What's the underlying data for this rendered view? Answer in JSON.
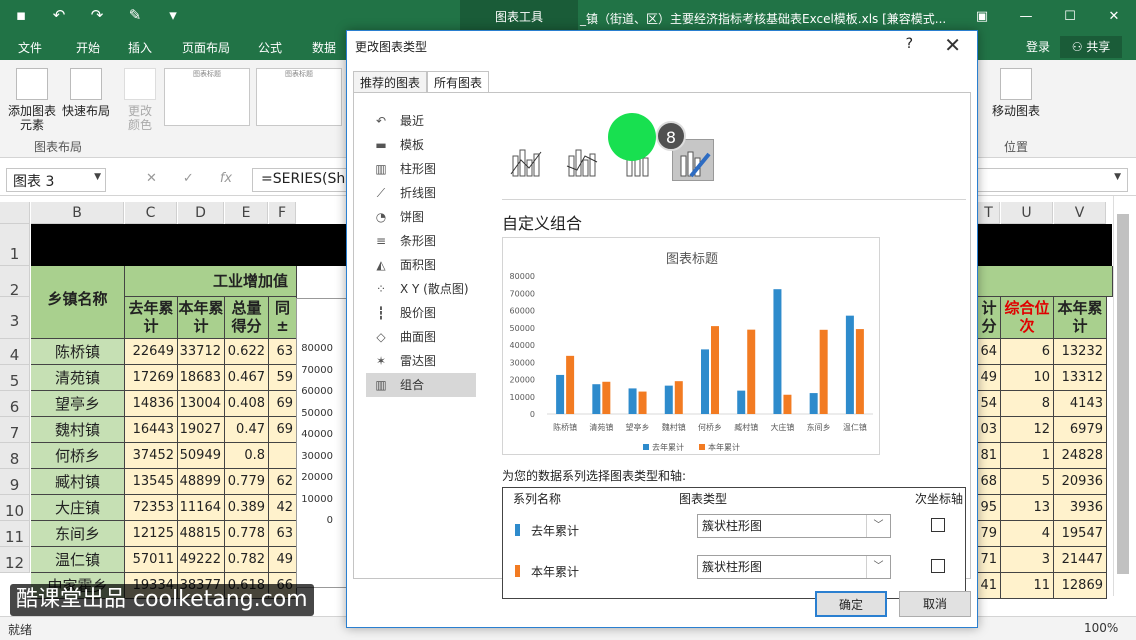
{
  "app": {
    "doc_title": "_镇（街道、区）主要经济指标考核基础表Excel模板.xls  [兼容模式...",
    "context_tab": "图表工具"
  },
  "ribbon_tabs": [
    "文件",
    "开始",
    "插入",
    "页面布局",
    "公式",
    "数据"
  ],
  "account": {
    "login": "登录",
    "share": "共享"
  },
  "ribbon": {
    "add_element": "添加图表\n元素",
    "quick_layout": "快速布局",
    "change_color": "更改\n颜色",
    "group_layout": "图表布局",
    "move_chart": "移动图表",
    "group_position": "位置",
    "thumb_title": "图表标题"
  },
  "formula_bar": {
    "name_box": "图表 3",
    "formula": "=SERIES(She"
  },
  "sheet": {
    "columns": [
      "B",
      "C",
      "D",
      "E",
      "F",
      "T",
      "U",
      "V"
    ],
    "rows": [
      "1",
      "2",
      "3",
      "4",
      "5",
      "6",
      "7",
      "8",
      "9",
      "10",
      "11",
      "12"
    ],
    "group_header": "工业增加值",
    "col_headers": [
      "乡镇名称",
      "去年累计",
      "本年累计",
      "总量得分",
      "同±",
      "计分",
      "综合位次",
      "本年累计"
    ],
    "names": [
      "陈桥镇",
      "清苑镇",
      "望亭乡",
      "魏村镇",
      "何桥乡",
      "臧村镇",
      "大庄镇",
      "东间乡",
      "温仁镇",
      "中家霍乡"
    ],
    "last_year": [
      "22649",
      "17269",
      "14836",
      "16443",
      "37452",
      "13545",
      "72353",
      "12125",
      "57011",
      "19334"
    ],
    "this_year": [
      "33712",
      "18683",
      "13004",
      "19027",
      "50949",
      "48899",
      "11164",
      "48815",
      "49222",
      "38377"
    ],
    "score": [
      "0.622",
      "0.467",
      "0.408",
      "0.47",
      "0.8",
      "0.779",
      "0.389",
      "0.778",
      "0.782",
      "0.618"
    ],
    "pct_frag": [
      "63",
      "59",
      "69",
      "69",
      "",
      "62",
      "42",
      "63",
      "49",
      "66"
    ],
    "t_col": [
      "64",
      "49",
      "54",
      "03",
      "81",
      "68",
      "95",
      "79",
      "71",
      "41"
    ],
    "u_col": [
      "6",
      "10",
      "8",
      "12",
      "1",
      "5",
      "13",
      "4",
      "3",
      "11"
    ],
    "v_col": [
      "13232",
      "13312",
      "4143",
      "6979",
      "24828",
      "20936",
      "3936",
      "19547",
      "21447",
      "12869"
    ],
    "chart_axis_ticks": [
      "80000",
      "70000",
      "60000",
      "50000",
      "40000",
      "30000",
      "20000",
      "10000",
      "0"
    ]
  },
  "statusbar": {
    "ready": "就绪",
    "zoom": "100%"
  },
  "watermark": "酷课堂出品 coolketang.com",
  "dialog": {
    "title": "更改图表类型",
    "help": "?",
    "close": "✕",
    "tabs": [
      "推荐的图表",
      "所有图表"
    ],
    "types": [
      {
        "label": "最近",
        "icon": "recent-icon"
      },
      {
        "label": "模板",
        "icon": "folder-icon"
      },
      {
        "label": "柱形图",
        "icon": "column-chart-icon"
      },
      {
        "label": "折线图",
        "icon": "line-chart-icon"
      },
      {
        "label": "饼图",
        "icon": "pie-chart-icon"
      },
      {
        "label": "条形图",
        "icon": "bar-chart-icon"
      },
      {
        "label": "面积图",
        "icon": "area-chart-icon"
      },
      {
        "label": "X Y (散点图)",
        "icon": "scatter-chart-icon"
      },
      {
        "label": "股价图",
        "icon": "stock-chart-icon"
      },
      {
        "label": "曲面图",
        "icon": "surface-chart-icon"
      },
      {
        "label": "雷达图",
        "icon": "radar-chart-icon"
      },
      {
        "label": "组合",
        "icon": "combo-chart-icon"
      }
    ],
    "step_badge": "8",
    "combo_title": "自定义组合",
    "axis_prompt": "为您的数据系列选择图表类型和轴:",
    "table_headers": [
      "系列名称",
      "图表类型",
      "次坐标轴"
    ],
    "series": [
      {
        "name": "去年累计",
        "color": "#2e8bcc",
        "type": "簇状柱形图",
        "secondary": false
      },
      {
        "name": "本年累计",
        "color": "#f27b22",
        "type": "簇状柱形图",
        "secondary": false
      }
    ],
    "ok": "确定",
    "cancel": "取消"
  },
  "chart_data": {
    "type": "bar",
    "title": "图表标题",
    "categories": [
      "陈桥镇",
      "清苑镇",
      "望亭乡",
      "魏村镇",
      "何桥乡",
      "臧村镇",
      "大庄镇",
      "东间乡",
      "温仁镇"
    ],
    "series": [
      {
        "name": "去年累计",
        "color": "#2e8bcc",
        "values": [
          22649,
          17269,
          14836,
          16443,
          37452,
          13545,
          72353,
          12125,
          57011
        ]
      },
      {
        "name": "本年累计",
        "color": "#f27b22",
        "values": [
          33712,
          18683,
          13004,
          19027,
          50949,
          48899,
          11164,
          48815,
          49222
        ]
      }
    ],
    "yticks": [
      0,
      10000,
      20000,
      30000,
      40000,
      50000,
      60000,
      70000,
      80000
    ],
    "ylim": [
      0,
      80000
    ],
    "legend": "bottom",
    "grid": false
  }
}
